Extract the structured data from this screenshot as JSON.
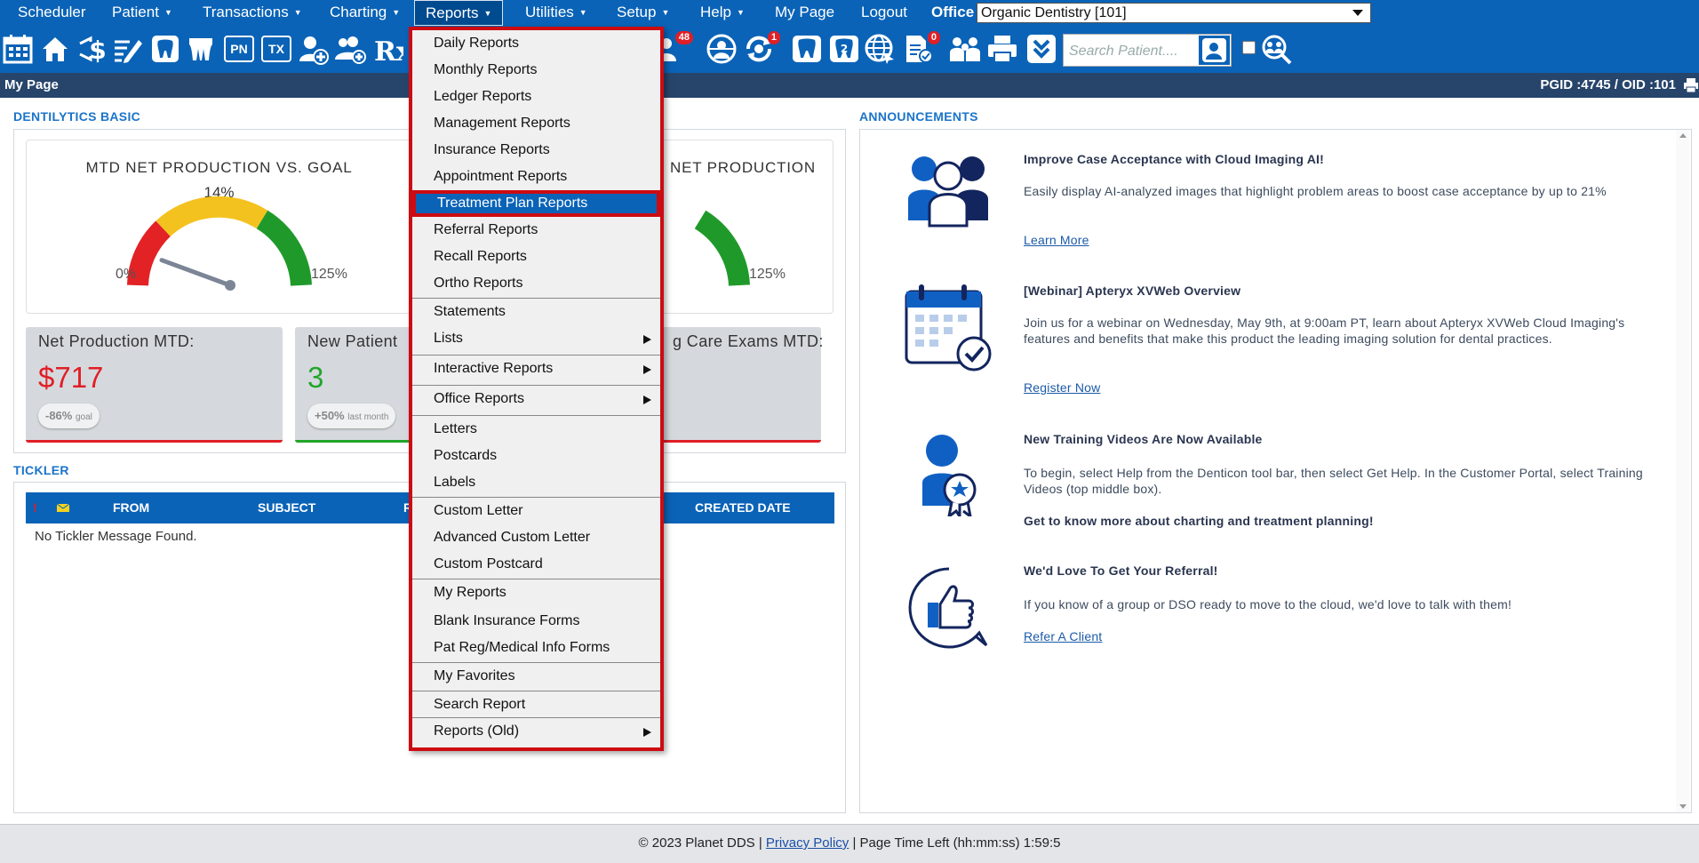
{
  "nav": {
    "items": [
      {
        "label": "Scheduler",
        "caret": false
      },
      {
        "label": "Patient",
        "caret": true
      },
      {
        "label": "Transactions",
        "caret": true
      },
      {
        "label": "Charting",
        "caret": true
      },
      {
        "label": "Reports",
        "caret": true
      },
      {
        "label": "Utilities",
        "caret": true
      },
      {
        "label": "Setup",
        "caret": true
      },
      {
        "label": "Help",
        "caret": true
      },
      {
        "label": "My Page",
        "caret": false
      },
      {
        "label": "Logout",
        "caret": false
      }
    ],
    "caret_glyph": "▼",
    "office_label": "Office",
    "office_value": "Organic Dentistry [101]"
  },
  "toolbar": {
    "icons": [
      "calendar-icon",
      "home-icon",
      "dollar-icon",
      "notes-icon",
      "tooth-icon",
      "teeth-icon",
      "pn-icon",
      "tx-icon",
      "add-patient-icon",
      "add-family-icon",
      "rx-icon",
      "messages-icon",
      "web-icon",
      "sync-icon",
      "tooth-chart-icon",
      "tooth-2-icon",
      "globe-icon",
      "forms-icon",
      "family-icon",
      "print-icon",
      "collapse-icon",
      "search-user-icon",
      "group-search-icon"
    ],
    "pn_label": "PN",
    "tx_label": "TX",
    "rx_label": "Rx",
    "badge_messages": "48",
    "badge_sync": "1",
    "badge_forms": "0",
    "search_placeholder": "Search Patient...."
  },
  "header": {
    "page_title": "My Page",
    "ids": "PGID :4745  /  OID :101"
  },
  "dentilytics": {
    "heading": "DENTILYTICS BASIC",
    "gauge1": {
      "title": "MTD NET PRODUCTION VS. GOAL",
      "percent": "14%",
      "min": "0%",
      "max": "125%",
      "value_fraction": 0.112
    },
    "gauge2": {
      "title": "NET PRODUCTION",
      "max": "125%"
    },
    "stats": [
      {
        "label": "Net Production MTD:",
        "value": "$717",
        "pill": "-86%",
        "pill_note": "goal",
        "color": "#e01f26"
      },
      {
        "label": "New Patient",
        "value": "3",
        "pill": "+50%",
        "pill_note": "last month",
        "color": "#22a52a"
      },
      {
        "label": "g Care Exams MTD:",
        "value": "",
        "pill": "",
        "pill_note": "",
        "color": "#e01f26"
      }
    ]
  },
  "tickler": {
    "heading": "TICKLER",
    "columns": [
      "FROM",
      "SUBJECT",
      "R",
      "CREATED DATE"
    ],
    "empty_message": "No Tickler Message Found."
  },
  "reports_menu": {
    "items": [
      {
        "label": "Daily Reports",
        "submenu": false
      },
      {
        "label": "Monthly Reports",
        "submenu": false
      },
      {
        "label": "Ledger Reports",
        "submenu": false
      },
      {
        "label": "Management Reports",
        "submenu": false
      },
      {
        "label": "Insurance Reports",
        "submenu": false
      },
      {
        "label": "Appointment Reports",
        "submenu": false
      },
      {
        "label": "Treatment Plan Reports",
        "submenu": false,
        "highlighted": true
      },
      {
        "label": "Referral Reports",
        "submenu": false
      },
      {
        "label": "Recall Reports",
        "submenu": false
      },
      {
        "label": "Ortho Reports",
        "submenu": false
      },
      {
        "label": "Statements",
        "submenu": false
      },
      {
        "label": "Lists",
        "submenu": true
      },
      {
        "label": "Interactive Reports",
        "submenu": true
      },
      {
        "label": "Office Reports",
        "submenu": true
      },
      {
        "label": "Letters",
        "submenu": false
      },
      {
        "label": "Postcards",
        "submenu": false
      },
      {
        "label": "Labels",
        "submenu": false
      },
      {
        "label": "Custom Letter",
        "submenu": false
      },
      {
        "label": "Advanced Custom Letter",
        "submenu": false
      },
      {
        "label": "Custom Postcard",
        "submenu": false
      },
      {
        "label": "My Reports",
        "submenu": false
      },
      {
        "label": "Blank Insurance Forms",
        "submenu": false
      },
      {
        "label": "Pat Reg/Medical Info Forms",
        "submenu": false
      },
      {
        "label": "My Favorites",
        "submenu": false
      },
      {
        "label": "Search Report",
        "submenu": false
      },
      {
        "label": "Reports (Old)",
        "submenu": true
      }
    ]
  },
  "announcements": {
    "heading": "ANNOUNCEMENTS",
    "items": [
      {
        "icon": "people-icon",
        "title": "Improve Case Acceptance with Cloud Imaging AI!",
        "body": "Easily display AI-analyzed images that highlight problem areas to boost case acceptance by up to 21%",
        "link": "Learn More"
      },
      {
        "icon": "calendar-check-icon",
        "title": "[Webinar] Apteryx XVWeb Overview",
        "body": "Join us for a webinar on Wednesday, May 9th, at 9:00am PT, learn about Apteryx XVWeb Cloud Imaging's features and benefits that make this product the leading imaging solution for dental practices.",
        "link": "Register Now"
      },
      {
        "icon": "training-award-icon",
        "title": "New Training Videos Are Now Available",
        "body": "To begin, select Help from the Denticon tool bar, then select Get Help. In the Customer Portal, select Training Videos (top middle box).",
        "subtitle": "Get to know more about charting and treatment planning!"
      },
      {
        "icon": "thumbs-up-icon",
        "title": "We'd Love To Get Your Referral!",
        "body": "If you know of a group or DSO ready to move to the cloud, we'd love to talk with them!",
        "link": "Refer A Client"
      }
    ]
  },
  "footer": {
    "copyright": "© 2023 Planet DDS |",
    "privacy": "Privacy Policy",
    "time_left": "|  Page Time Left (hh:mm:ss) 1:59:5"
  },
  "colors": {
    "nav_bg": "#0a63b7",
    "header_bg": "#27456b",
    "menu_border": "#cc0b12",
    "negative": "#e01f26",
    "positive": "#22a52a"
  }
}
